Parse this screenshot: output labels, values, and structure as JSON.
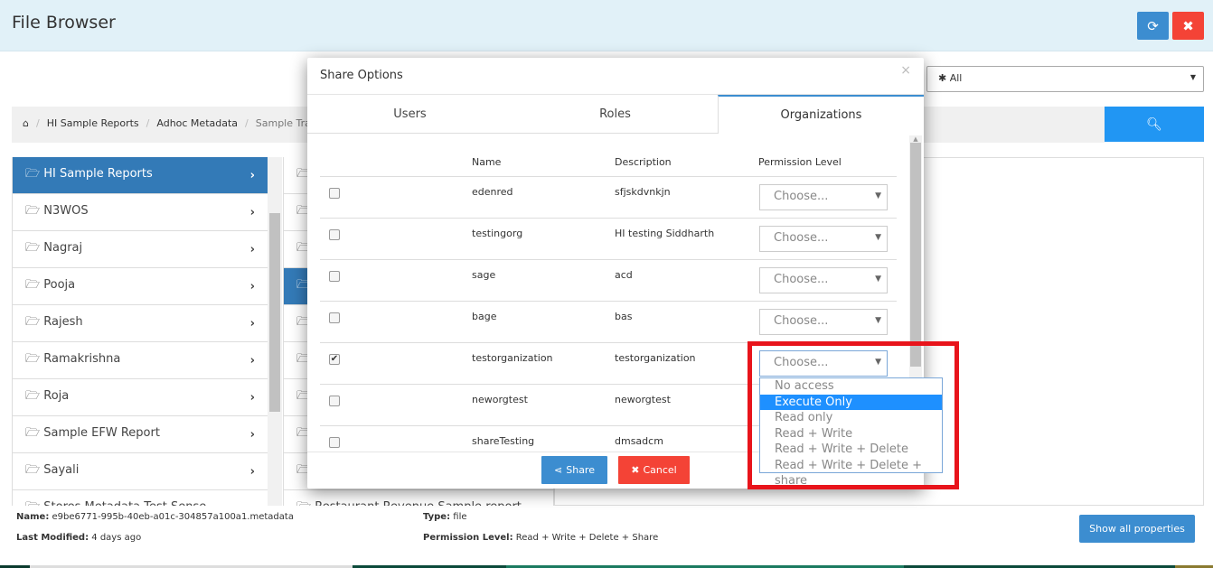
{
  "header": {
    "title": "File Browser",
    "refresh_icon": "refresh-icon",
    "close_icon": "close-icon",
    "refresh_color": "#3c8dd0",
    "close_color": "#f44336"
  },
  "filter": {
    "value": "✱ All"
  },
  "breadcrumb": [
    "HI Sample Reports",
    "Adhoc Metadata",
    "Sample Travel M"
  ],
  "left_list": [
    "HI Sample Reports",
    "N3WOS",
    "Nagraj",
    "Pooja",
    "Rajesh",
    "Ramakrishna",
    "Roja",
    "Sample EFW Report",
    "Sayali",
    "Stores Metadata Test Sense"
  ],
  "column2_last": "Restaurant Revenue Sample report",
  "info": {
    "name_label": "Name:",
    "name": "e9be6771-995b-40eb-a01c-304857a100a1.metadata",
    "modified_label": "Last Modified:",
    "modified": "4 days ago",
    "type_label": "Type:",
    "type": "file",
    "perm_label": "Permission Level:",
    "perm": "Read + Write + Delete + Share",
    "show_all": "Show all properties"
  },
  "modal": {
    "title": "Share Options",
    "close": "×",
    "tabs": [
      "Users",
      "Roles",
      "Organizations"
    ],
    "active_tab": "Organizations",
    "columns": [
      "Name",
      "Description",
      "Permission Level"
    ],
    "rows": [
      {
        "name": "edenred",
        "desc": "sfjskdvnkjn",
        "perm": "Choose...",
        "checked": false
      },
      {
        "name": "testingorg",
        "desc": "HI testing Siddharth",
        "perm": "Choose...",
        "checked": false
      },
      {
        "name": "sage",
        "desc": "acd",
        "perm": "Choose...",
        "checked": false
      },
      {
        "name": "bage",
        "desc": "bas",
        "perm": "Choose...",
        "checked": false
      },
      {
        "name": "testorganization",
        "desc": "testorganization",
        "perm": "Choose...",
        "checked": true
      },
      {
        "name": "neworgtest",
        "desc": "neworgtest",
        "perm": "",
        "checked": false
      },
      {
        "name": "shareTesting",
        "desc": "dmsadcm",
        "perm": "",
        "checked": false
      }
    ],
    "share": "Share",
    "cancel": "Cancel"
  },
  "dropdown": {
    "options": [
      "No access",
      "Execute Only",
      "Read only",
      "Read + Write",
      "Read + Write + Delete",
      "Read + Write + Delete + share"
    ],
    "highlighted": "Execute Only"
  }
}
